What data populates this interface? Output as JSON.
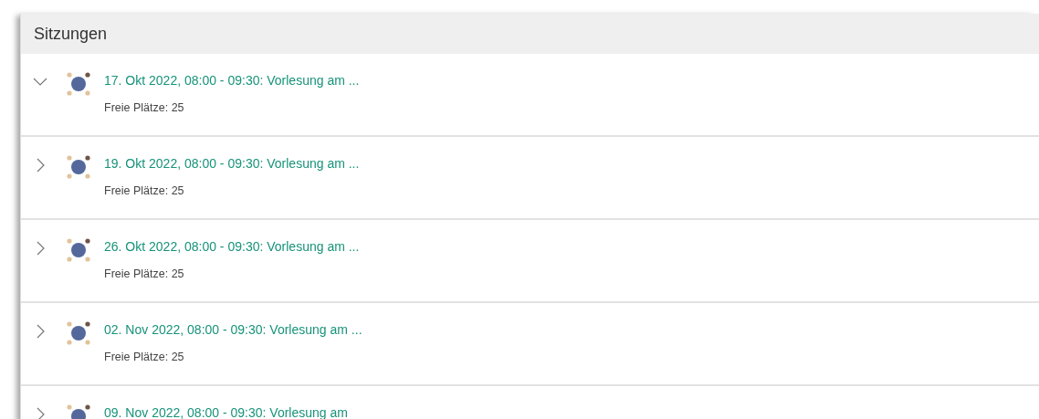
{
  "panel": {
    "title": "Sitzungen"
  },
  "sessions": [
    {
      "title": "17. Okt 2022, 08:00 - 09:30: Vorlesung am ...",
      "subtitle": "Freie Plätze: 25",
      "expanded": true
    },
    {
      "title": "19. Okt 2022, 08:00 - 09:30: Vorlesung am ...",
      "subtitle": "Freie Plätze: 25",
      "expanded": false
    },
    {
      "title": "26. Okt 2022, 08:00 - 09:30: Vorlesung am ...",
      "subtitle": "Freie Plätze: 25",
      "expanded": false
    },
    {
      "title": "02. Nov 2022, 08:00 - 09:30: Vorlesung am ...",
      "subtitle": "Freie Plätze: 25",
      "expanded": false
    },
    {
      "title": "09. Nov 2022, 08:00 - 09:30: Vorlesung am",
      "expanded": false
    }
  ]
}
